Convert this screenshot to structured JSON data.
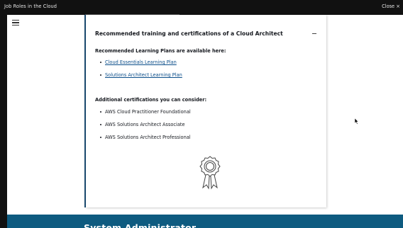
{
  "window": {
    "title": "Job Roles in the Cloud",
    "close_label": "Close",
    "close_glyph": "×"
  },
  "card": {
    "heading": "Recommended training and certifications of a Cloud Architect",
    "learning_plans_label": "Recommended Learning Plans are available here:",
    "learning_plans": [
      {
        "label": "Cloud Essentials Learning Plan"
      },
      {
        "label": "Solutions Architect Learning Plan"
      }
    ],
    "certifications_label": "Additional certifications you can consider:",
    "certifications": [
      {
        "label": "AWS Cloud Practitioner Foundational"
      },
      {
        "label": "AWS Solutions Architect Associate"
      },
      {
        "label": "AWS Solutions Architect Professional"
      }
    ],
    "badge_icon": "award-ribbon-icon"
  },
  "next_section": {
    "title": "System Administrator"
  },
  "colors": {
    "banner": "#0e5b80",
    "accent_rule": "#1a4a70",
    "link": "#0b4e8a"
  }
}
